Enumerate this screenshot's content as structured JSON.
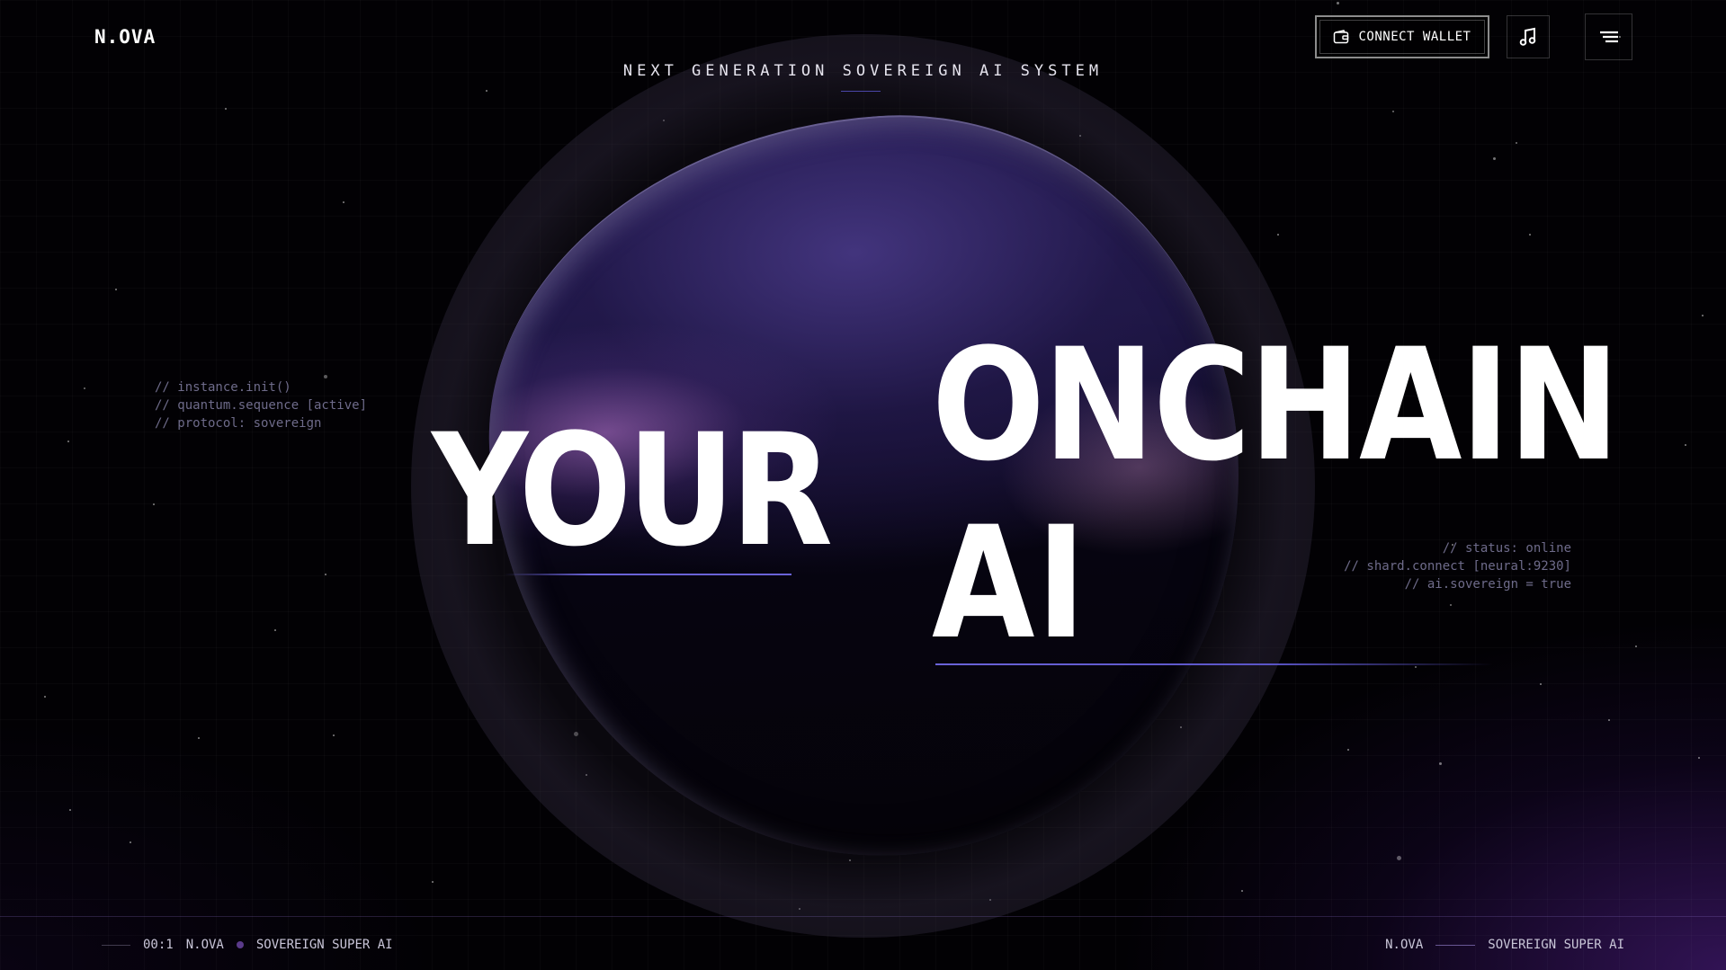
{
  "header": {
    "logo": "N.OVA",
    "connect_wallet_label": "CONNECT WALLET",
    "wallet_icon": "wallet-icon",
    "music_icon": "music-note-icon",
    "menu_icon": "menu-icon"
  },
  "hero": {
    "tagline": "NEXT GENERATION SOVEREIGN AI SYSTEM",
    "word_1": "YOUR",
    "word_2": "ONCHAIN",
    "word_3": "AI"
  },
  "code_left": {
    "line_1": "// instance.init()",
    "line_2": "// quantum.sequence [active]",
    "line_3": "// protocol: sovereign"
  },
  "code_right": {
    "line_1": "// status: online",
    "line_2": "// shard.connect [neural:9230]",
    "line_3": "// ai.sovereign = true"
  },
  "footer": {
    "left_counter": "00:1",
    "left_brand": "N.OVA",
    "left_title": "SOVEREIGN SUPER AI",
    "right_brand": "N.OVA",
    "right_title": "SOVEREIGN SUPER AI"
  },
  "colors": {
    "background": "#020104",
    "accent_line": "#6a63d8",
    "code_text": "#6e6b8a",
    "purple_glow": "#582296"
  }
}
